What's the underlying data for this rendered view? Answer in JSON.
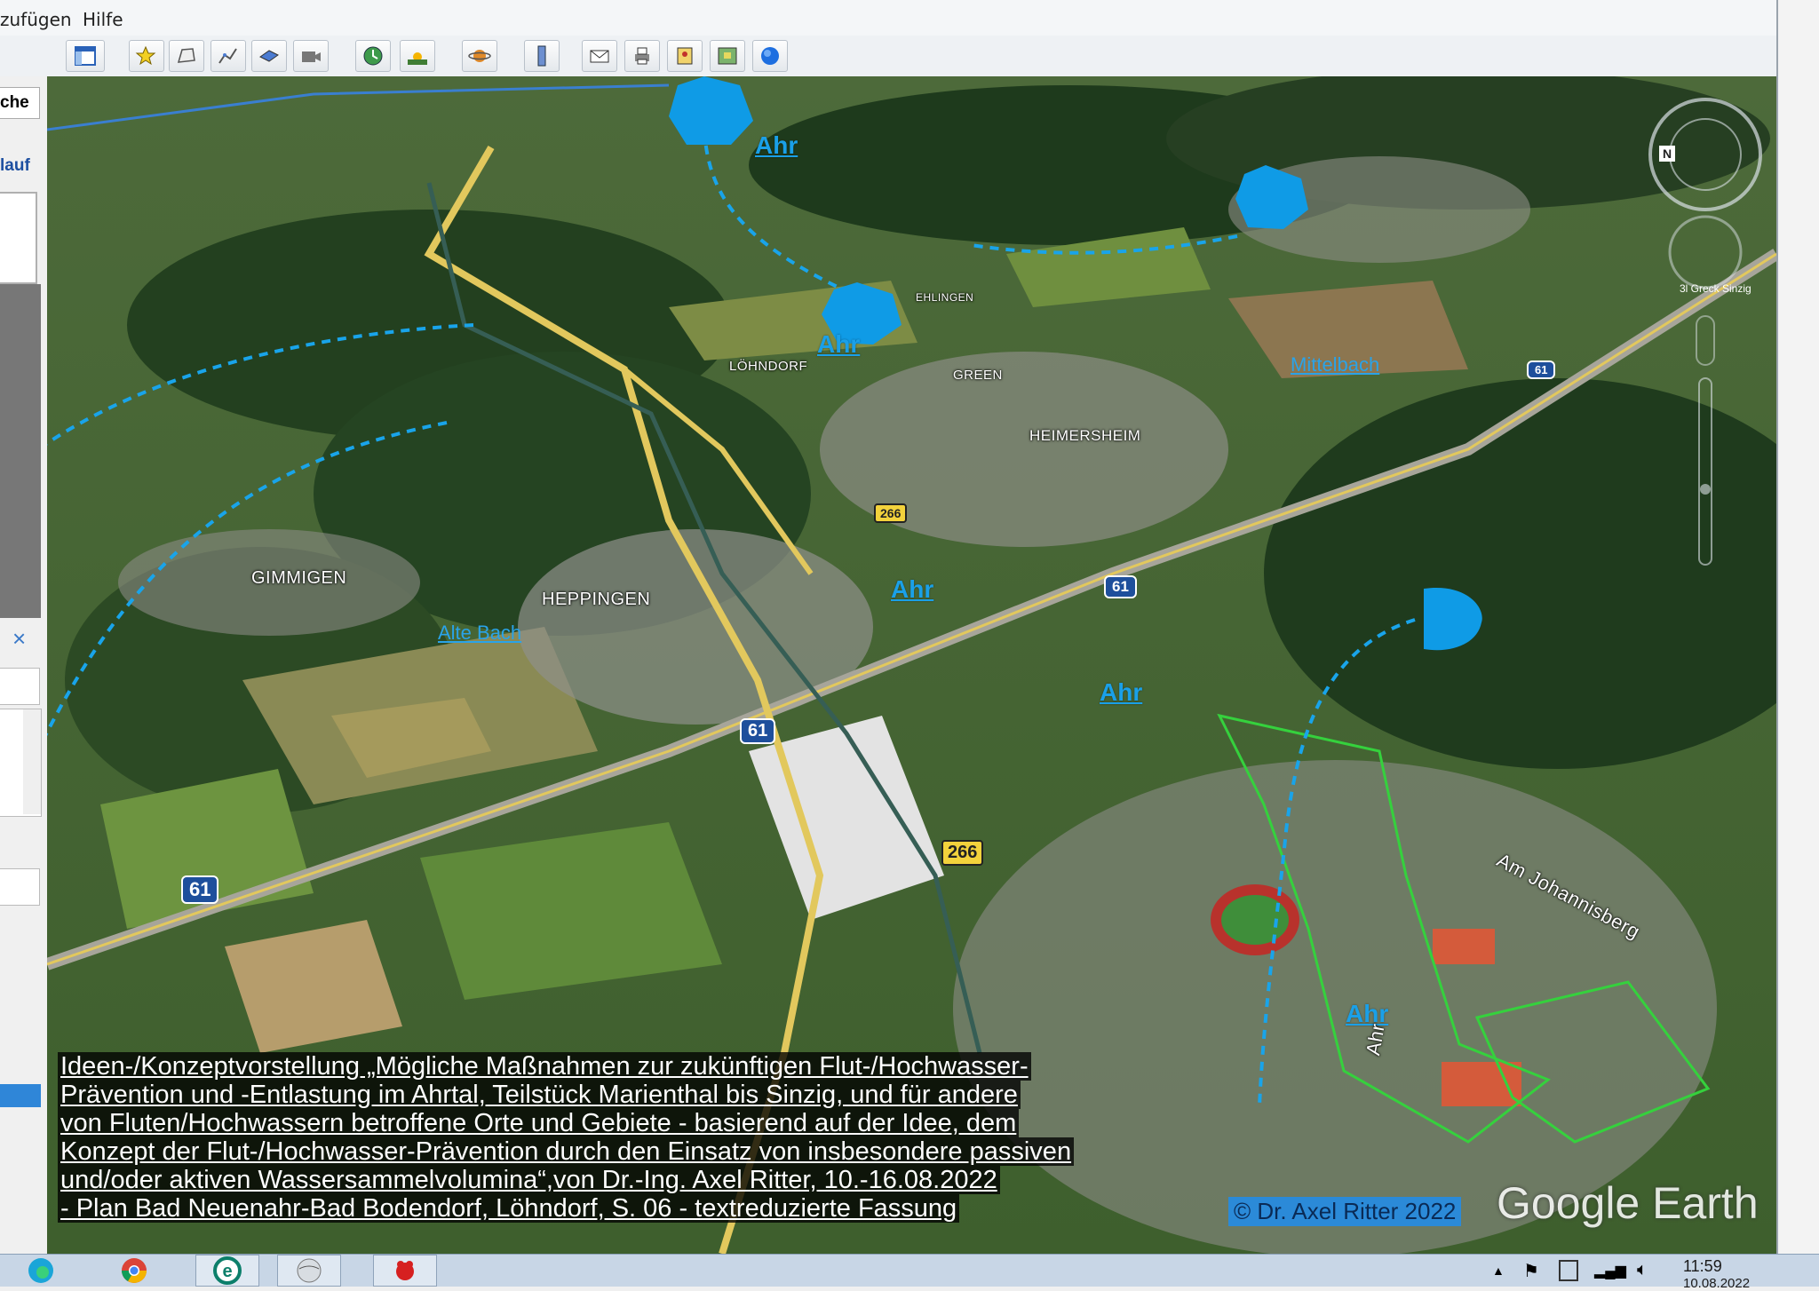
{
  "menubar": {
    "items": [
      "zufügen",
      "Hilfe"
    ]
  },
  "toolbar": {
    "buttons": [
      {
        "icon": "sidebar-panel-icon"
      },
      {
        "icon": "add-placemark-icon"
      },
      {
        "icon": "add-polygon-icon"
      },
      {
        "icon": "add-path-icon"
      },
      {
        "icon": "add-image-overlay-icon"
      },
      {
        "icon": "record-tour-icon"
      },
      {
        "icon": "historical-imagery-icon"
      },
      {
        "icon": "sunlight-icon"
      },
      {
        "icon": "switch-planet-icon"
      },
      {
        "icon": "ruler-icon"
      },
      {
        "icon": "email-icon"
      },
      {
        "icon": "print-icon"
      },
      {
        "icon": "save-image-icon"
      },
      {
        "icon": "view-in-maps-icon"
      },
      {
        "icon": "earth-globe-icon"
      }
    ]
  },
  "sidebar": {
    "search_label": "che",
    "tour_label": "lauf",
    "close_glyph": "×"
  },
  "map": {
    "places": [
      "GIMMIGEN",
      "HEPPINGEN",
      "HEIMERSHEIM",
      "LÖHNDORF",
      "GREEN",
      "EHLINGEN"
    ],
    "water_labels": [
      "Ahr",
      "Ahr",
      "Ahr",
      "Ahr",
      "Ahr"
    ],
    "streams": [
      "Mittelbach",
      "Alte Bach"
    ],
    "roads": [
      "Am Johannisberg",
      "Ahr"
    ],
    "route_shields": [
      "61",
      "61",
      "61",
      "61"
    ],
    "route_yellow": [
      "266",
      "266"
    ],
    "compass_letter": "N",
    "watermark_corner": "3l Greck Sinzig"
  },
  "caption": {
    "lines": [
      "Ideen-/Konzeptvorstellung „Mögliche Maßnahmen zur zukünftigen Flut-/Hochwasser-",
      "Prävention und -Entlastung im Ahrtal, Teilstück Marienthal bis Sinzig, und für andere",
      "von Fluten/Hochwassern betroffene Orte und Gebiete - basierend auf der Idee, dem",
      "Konzept der Flut-/Hochwasser-Prävention durch den Einsatz von insbesondere passiven",
      "und/oder aktiven Wassersammelvolumina“,von Dr.-Ing. Axel Ritter, 10.-16.08.2022",
      "- Plan Bad Neuenahr-Bad Bodendorf, Löhndorf, S. 06 - textreduzierte Fassung"
    ]
  },
  "copyright": "© Dr. Axel Ritter 2022",
  "logo": "Google Earth",
  "taskbar": {
    "apps": [
      "edge-icon",
      "chrome-icon",
      "ie-edge-icon",
      "google-earth-icon",
      "app-red-icon"
    ],
    "time": "11:59",
    "date": "10.08.2022"
  },
  "colors": {
    "water_marker": "#0f9be6",
    "dashed_line": "#19a4ea",
    "outline_green": "#35d13d"
  }
}
